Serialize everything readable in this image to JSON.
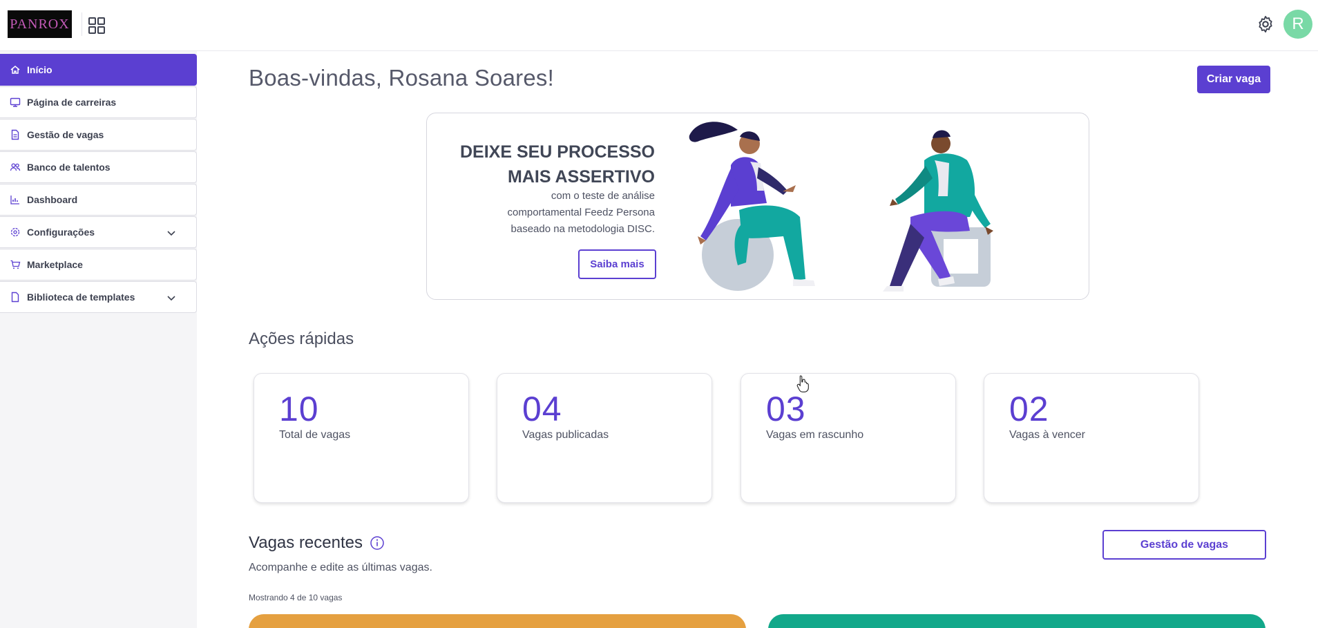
{
  "header": {
    "logo_text": "PANROX",
    "avatar_letter": "R",
    "icons": [
      "apps-grid-icon",
      "gear-icon"
    ]
  },
  "sidebar": {
    "items": [
      {
        "label": "Início",
        "icon": "home-icon",
        "active": true
      },
      {
        "label": "Página de carreiras",
        "icon": "monitor-icon"
      },
      {
        "label": "Gestão de vagas",
        "icon": "document-icon"
      },
      {
        "label": "Banco de talentos",
        "icon": "users-icon"
      },
      {
        "label": "Dashboard",
        "icon": "bar-chart-icon"
      },
      {
        "label": "Configurações",
        "icon": "gear-icon",
        "expandable": true
      },
      {
        "label": "Marketplace",
        "icon": "cart-icon"
      },
      {
        "label": "Biblioteca de templates",
        "icon": "file-icon",
        "expandable": true
      }
    ]
  },
  "main": {
    "welcome": "Boas-vindas, Rosana Soares!",
    "create_button": "Criar vaga",
    "banner": {
      "title_line1": "DEIXE SEU PROCESSO",
      "title_line2": "MAIS ASSERTIVO",
      "text_line1": "com o teste de análise",
      "text_line2": "comportamental Feedz Persona",
      "text_line3": "baseado na metodologia DISC.",
      "button": "Saiba mais"
    },
    "quick_actions": {
      "title": "Ações rápidas",
      "cards": [
        {
          "number": "10",
          "label": "Total de vagas"
        },
        {
          "number": "04",
          "label": "Vagas publicadas"
        },
        {
          "number": "03",
          "label": "Vagas em rascunho"
        },
        {
          "number": "02",
          "label": "Vagas à vencer"
        }
      ]
    },
    "recent": {
      "title": "Vagas recentes",
      "subtitle": "Acompanhe e edite as últimas vagas.",
      "showing": "Mostrando 4 de 10 vagas",
      "manage_button": "Gestão de vagas"
    }
  },
  "colors": {
    "accent": "#5b3fd1",
    "avatar": "#79d9a6",
    "job_card_1": "#e5a040",
    "job_card_2": "#12a88a"
  }
}
